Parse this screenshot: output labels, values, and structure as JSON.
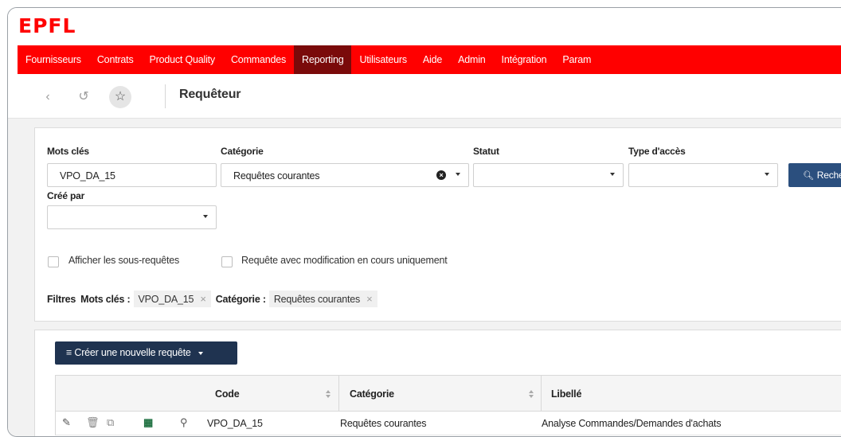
{
  "logo": "EPFL",
  "nav": [
    {
      "label": "Fournisseurs",
      "active": false
    },
    {
      "label": "Contrats",
      "active": false
    },
    {
      "label": "Product Quality",
      "active": false
    },
    {
      "label": "Commandes",
      "active": false
    },
    {
      "label": "Reporting",
      "active": true
    },
    {
      "label": "Utilisateurs",
      "active": false
    },
    {
      "label": "Aide",
      "active": false
    },
    {
      "label": "Admin",
      "active": false
    },
    {
      "label": "Intégration",
      "active": false
    },
    {
      "label": "Param",
      "active": false
    }
  ],
  "toolbar": {
    "title": "Requêteur",
    "icons": [
      "back-icon",
      "history-icon",
      "star-icon"
    ]
  },
  "filters": {
    "keywords": {
      "label": "Mots clés",
      "value": "VPO_DA_15"
    },
    "category": {
      "label": "Catégorie",
      "value": "Requêtes courantes"
    },
    "status": {
      "label": "Statut",
      "value": ""
    },
    "access_type": {
      "label": "Type d'accès",
      "value": ""
    },
    "created_by": {
      "label": "Créé par",
      "value": ""
    },
    "search_label": "Recher",
    "show_subqueries": "Afficher les sous-requêtes",
    "in_progress_only": "Requête avec modification en cours uniquement",
    "active": {
      "title": "Filtres",
      "chips": [
        {
          "key": "Mots clés :",
          "value": "VPO_DA_15"
        },
        {
          "key": "Catégorie :",
          "value": "Requêtes courantes"
        }
      ]
    }
  },
  "list": {
    "create_label": "Créer une nouvelle requête",
    "columns": [
      "Code",
      "Catégorie",
      "Libellé"
    ],
    "rows": [
      {
        "code": "VPO_DA_15",
        "category": "Requêtes courantes",
        "label": "Analyse Commandes/Demandes d'achats"
      }
    ]
  },
  "colors": {
    "brand": "#ff0000",
    "nav_active": "#7a0a0a",
    "primary_button": "#2b4f7e",
    "create_button": "#1f3350"
  }
}
